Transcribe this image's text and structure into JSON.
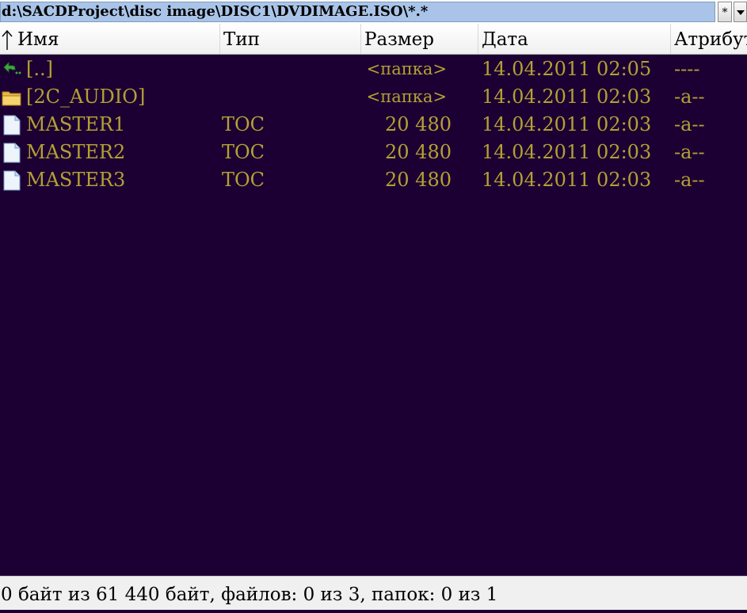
{
  "path": {
    "value": "d:\\SACDProject\\disc image\\DISC1\\DVDIMAGE.ISO\\*.*",
    "filter_label": "*"
  },
  "columns": {
    "name": "Имя",
    "type": "Тип",
    "size": "Размер",
    "date": "Дата",
    "attr": "Атрибуты"
  },
  "rows": [
    {
      "icon": "up-dir-icon",
      "name": "[..]",
      "type": "",
      "size": "<папка>",
      "date": "14.04.2011 02:05",
      "attr": "----"
    },
    {
      "icon": "folder-icon",
      "name": "[2C_AUDIO]",
      "type": "",
      "size": "<папка>",
      "date": "14.04.2011 02:03",
      "attr": "-a--"
    },
    {
      "icon": "file-icon",
      "name": "MASTER1",
      "type": "TOC",
      "size": "20 480",
      "date": "14.04.2011 02:03",
      "attr": "-a--"
    },
    {
      "icon": "file-icon",
      "name": "MASTER2",
      "type": "TOC",
      "size": "20 480",
      "date": "14.04.2011 02:03",
      "attr": "-a--"
    },
    {
      "icon": "file-icon",
      "name": "MASTER3",
      "type": "TOC",
      "size": "20 480",
      "date": "14.04.2011 02:03",
      "attr": "-a--"
    }
  ],
  "status": "0 байт из 61 440 байт, файлов: 0 из 3, папок: 0 из 1",
  "colors": {
    "background": "#1c0033",
    "text": "#b4a034",
    "path_bg": "#a9c4e8"
  }
}
